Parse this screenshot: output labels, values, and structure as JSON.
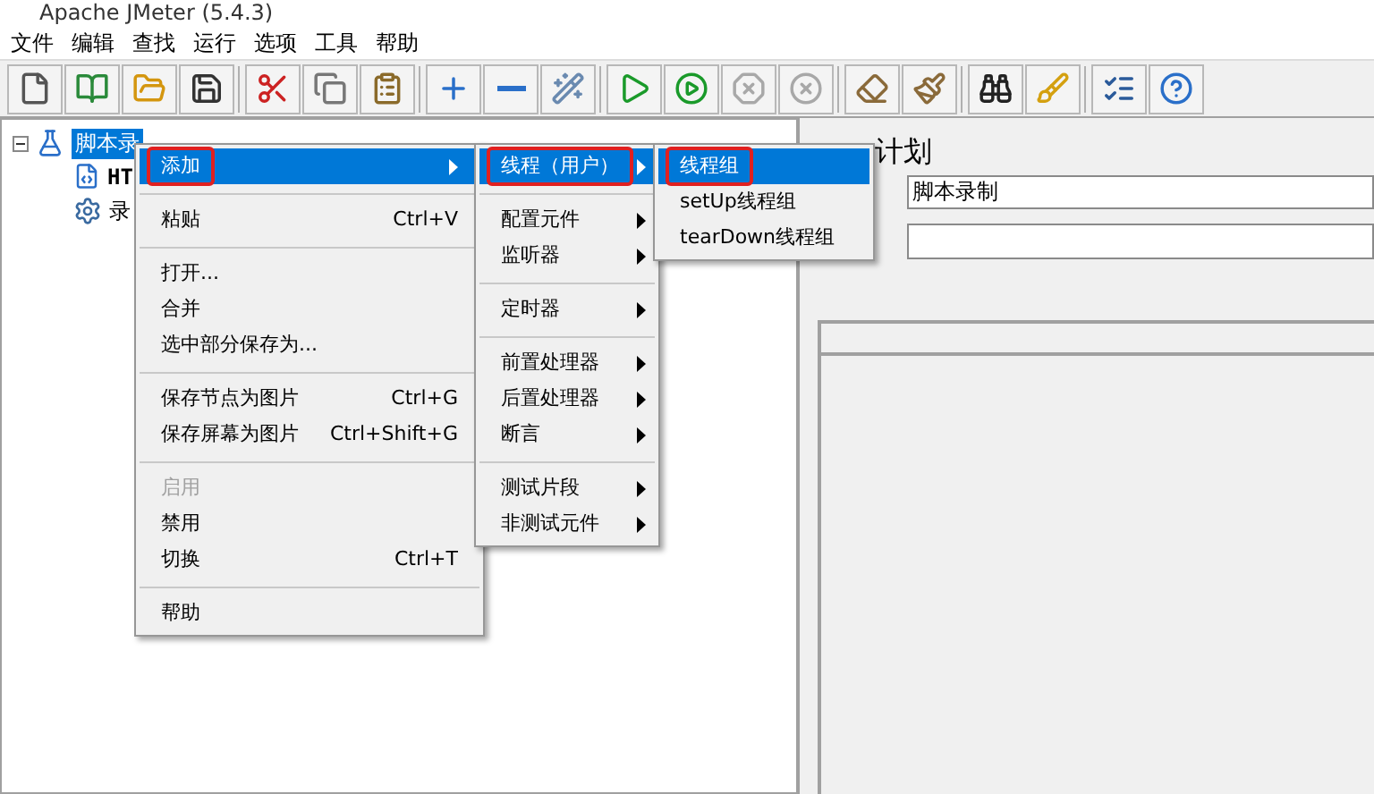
{
  "window": {
    "title": "Apache JMeter (5.4.3)"
  },
  "menu_bar": [
    "文件",
    "编辑",
    "查找",
    "运行",
    "选项",
    "工具",
    "帮助"
  ],
  "toolbar": [
    {
      "kind": "new",
      "disabled": false
    },
    {
      "kind": "templates",
      "disabled": false
    },
    {
      "kind": "open",
      "disabled": false
    },
    {
      "kind": "save",
      "disabled": false
    },
    {
      "kind": "separator"
    },
    {
      "kind": "cut",
      "disabled": false
    },
    {
      "kind": "copy",
      "disabled": false
    },
    {
      "kind": "paste",
      "disabled": false
    },
    {
      "kind": "separator"
    },
    {
      "kind": "expand",
      "disabled": false
    },
    {
      "kind": "collapse",
      "disabled": false
    },
    {
      "kind": "toggle",
      "disabled": false
    },
    {
      "kind": "separator"
    },
    {
      "kind": "start",
      "disabled": false
    },
    {
      "kind": "start_no_timers",
      "disabled": false
    },
    {
      "kind": "stop",
      "disabled": true
    },
    {
      "kind": "shutdown",
      "disabled": true
    },
    {
      "kind": "separator"
    },
    {
      "kind": "clear",
      "disabled": false
    },
    {
      "kind": "clear_all",
      "disabled": false
    },
    {
      "kind": "separator"
    },
    {
      "kind": "search",
      "disabled": false
    },
    {
      "kind": "reset_search",
      "disabled": false
    },
    {
      "kind": "separator"
    },
    {
      "kind": "functions",
      "disabled": false
    },
    {
      "kind": "help",
      "disabled": false
    }
  ],
  "tree": {
    "label": "脚本录",
    "selected": true,
    "expanded": true,
    "children": [
      {
        "label": "HT",
        "kind": "script"
      },
      {
        "label": "录",
        "kind": "gear"
      }
    ]
  },
  "panel": {
    "title": "计划",
    "name_value": "脚本录制"
  },
  "context_menu": [
    {
      "kind": "item",
      "label": "添加",
      "submenu": true,
      "highlighted": true,
      "annotated": true,
      "disabled": false
    },
    {
      "kind": "separator"
    },
    {
      "kind": "item",
      "label": "粘贴",
      "shortcut": "Ctrl+V",
      "submenu": false,
      "highlighted": false,
      "annotated": false,
      "disabled": false
    },
    {
      "kind": "separator"
    },
    {
      "kind": "item",
      "label": "打开...",
      "submenu": false,
      "highlighted": false,
      "annotated": false,
      "disabled": false
    },
    {
      "kind": "item",
      "label": "合并",
      "submenu": false,
      "highlighted": false,
      "annotated": false,
      "disabled": false
    },
    {
      "kind": "item",
      "label": "选中部分保存为...",
      "submenu": false,
      "highlighted": false,
      "annotated": false,
      "disabled": false
    },
    {
      "kind": "separator"
    },
    {
      "kind": "item",
      "label": "保存节点为图片",
      "shortcut": "Ctrl+G",
      "submenu": false,
      "highlighted": false,
      "annotated": false,
      "disabled": false
    },
    {
      "kind": "item",
      "label": "保存屏幕为图片",
      "shortcut": "Ctrl+Shift+G",
      "submenu": false,
      "highlighted": false,
      "annotated": false,
      "disabled": false
    },
    {
      "kind": "separator"
    },
    {
      "kind": "item",
      "label": "启用",
      "submenu": false,
      "highlighted": false,
      "annotated": false,
      "disabled": true
    },
    {
      "kind": "item",
      "label": "禁用",
      "submenu": false,
      "highlighted": false,
      "annotated": false,
      "disabled": false
    },
    {
      "kind": "item",
      "label": "切换",
      "shortcut": "Ctrl+T",
      "submenu": false,
      "highlighted": false,
      "annotated": false,
      "disabled": false
    },
    {
      "kind": "separator"
    },
    {
      "kind": "item",
      "label": "帮助",
      "submenu": false,
      "highlighted": false,
      "annotated": false,
      "disabled": false
    }
  ],
  "add_submenu": [
    {
      "kind": "item",
      "label": "线程（用户）",
      "submenu": true,
      "highlighted": true,
      "annotated": true,
      "disabled": false
    },
    {
      "kind": "separator"
    },
    {
      "kind": "item",
      "label": "配置元件",
      "submenu": true,
      "highlighted": false,
      "annotated": false,
      "disabled": false
    },
    {
      "kind": "item",
      "label": "监听器",
      "submenu": true,
      "highlighted": false,
      "annotated": false,
      "disabled": false
    },
    {
      "kind": "separator"
    },
    {
      "kind": "item",
      "label": "定时器",
      "submenu": true,
      "highlighted": false,
      "annotated": false,
      "disabled": false
    },
    {
      "kind": "separator"
    },
    {
      "kind": "item",
      "label": "前置处理器",
      "submenu": true,
      "highlighted": false,
      "annotated": false,
      "disabled": false
    },
    {
      "kind": "item",
      "label": "后置处理器",
      "submenu": true,
      "highlighted": false,
      "annotated": false,
      "disabled": false
    },
    {
      "kind": "item",
      "label": "断言",
      "submenu": true,
      "highlighted": false,
      "annotated": false,
      "disabled": false
    },
    {
      "kind": "separator"
    },
    {
      "kind": "item",
      "label": "测试片段",
      "submenu": true,
      "highlighted": false,
      "annotated": false,
      "disabled": false
    },
    {
      "kind": "item",
      "label": "非测试元件",
      "submenu": true,
      "highlighted": false,
      "annotated": false,
      "disabled": false
    }
  ],
  "threads_submenu": [
    {
      "kind": "item",
      "label": "线程组",
      "submenu": false,
      "highlighted": true,
      "annotated": true,
      "disabled": false
    },
    {
      "kind": "item",
      "label": "setUp线程组",
      "submenu": false,
      "highlighted": false,
      "annotated": false,
      "disabled": false
    },
    {
      "kind": "item",
      "label": "tearDown线程组",
      "submenu": false,
      "highlighted": false,
      "annotated": false,
      "disabled": false
    }
  ]
}
